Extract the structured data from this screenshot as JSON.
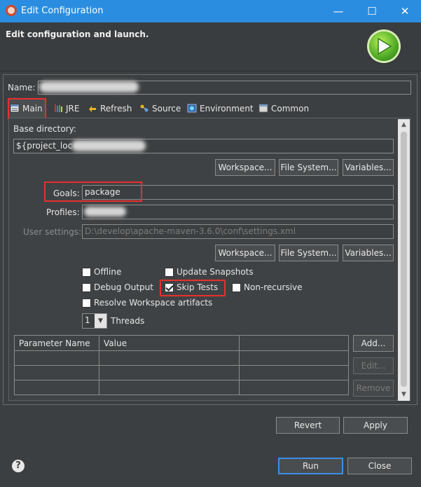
{
  "window": {
    "title": "Edit Configuration",
    "minimize": "—",
    "maximize": "☐",
    "close": "✕"
  },
  "header": {
    "title": "Edit configuration and launch."
  },
  "name": {
    "label": "Name:",
    "value": ""
  },
  "tabs": [
    {
      "label": "Main",
      "icon": "main-tab-icon"
    },
    {
      "label": "JRE",
      "icon": "jre-icon"
    },
    {
      "label": "Refresh",
      "icon": "refresh-icon"
    },
    {
      "label": "Source",
      "icon": "source-icon"
    },
    {
      "label": "Environment",
      "icon": "environment-icon"
    },
    {
      "label": "Common",
      "icon": "common-icon"
    }
  ],
  "main": {
    "base_directory_label": "Base directory:",
    "base_directory_value": "${project_loc",
    "workspace_btn": "Workspace...",
    "filesystem_btn": "File System...",
    "variables_btn": "Variables...",
    "goals_label": "Goals:",
    "goals_value": "package",
    "profiles_label": "Profiles:",
    "profiles_value": "",
    "user_settings_label": "User settings:",
    "user_settings_value": "D:\\develop\\apache-maven-3.6.0\\conf\\settings.xml",
    "offline": "Offline",
    "update_snapshots": "Update Snapshots",
    "debug_output": "Debug Output",
    "skip_tests": "Skip Tests",
    "non_recursive": "Non-recursive",
    "resolve_workspace": "Resolve Workspace artifacts",
    "threads_value": "1",
    "threads_label": "Threads",
    "param_headers": [
      "Parameter Name",
      "Value",
      ""
    ],
    "add_btn": "Add...",
    "edit_btn": "Edit...",
    "remove_btn": "Remove"
  },
  "footer": {
    "revert": "Revert",
    "apply": "Apply",
    "run": "Run",
    "close": "Close",
    "help": "?"
  },
  "colors": {
    "titlebar": "#2b8de0",
    "background": "#3c3f41",
    "highlight": "#e8302f"
  }
}
